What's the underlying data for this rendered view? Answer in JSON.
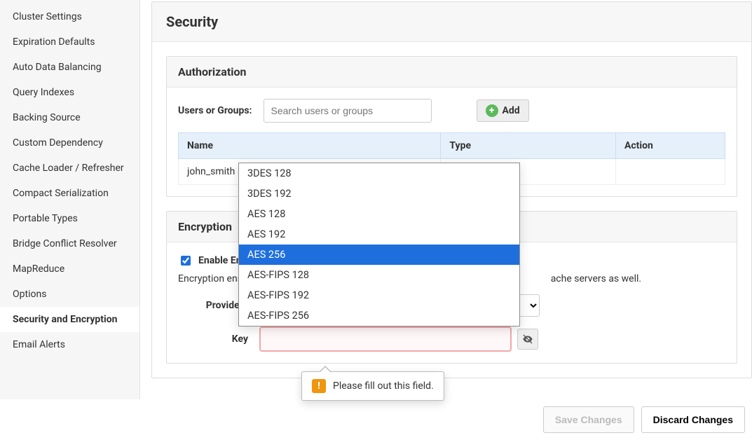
{
  "sidebar": {
    "items": [
      {
        "label": "Cluster Settings"
      },
      {
        "label": "Expiration Defaults"
      },
      {
        "label": "Auto Data Balancing"
      },
      {
        "label": "Query Indexes"
      },
      {
        "label": "Backing Source"
      },
      {
        "label": "Custom Dependency"
      },
      {
        "label": "Cache Loader / Refresher"
      },
      {
        "label": "Compact Serialization"
      },
      {
        "label": "Portable Types"
      },
      {
        "label": "Bridge Conflict Resolver"
      },
      {
        "label": "MapReduce"
      },
      {
        "label": "Options"
      },
      {
        "label": "Security and Encryption"
      },
      {
        "label": "Email Alerts"
      }
    ]
  },
  "page": {
    "title": "Security"
  },
  "authorization": {
    "header": "Authorization",
    "search_label": "Users or Groups:",
    "search_placeholder": "Search users or groups",
    "add_label": "Add",
    "columns": {
      "name": "Name",
      "type": "Type",
      "action": "Action"
    },
    "rows": [
      {
        "name": "john_smith"
      }
    ]
  },
  "encryption": {
    "header": "Encryption",
    "enable_label": "Enable Encryption",
    "enable_checked": true,
    "desc_prefix": "Encryption ensure",
    "desc_suffix": "ache servers as well.",
    "providers_label": "Providers",
    "providers_selected": "AES 256",
    "providers_options": [
      "3DES 128",
      "3DES 192",
      "AES 128",
      "AES 192",
      "AES 256",
      "AES-FIPS 128",
      "AES-FIPS 192",
      "AES-FIPS 256"
    ],
    "key_label": "Key"
  },
  "tooltip": {
    "text": "Please fill out this field."
  },
  "footer": {
    "save": "Save Changes",
    "discard": "Discard Changes"
  }
}
